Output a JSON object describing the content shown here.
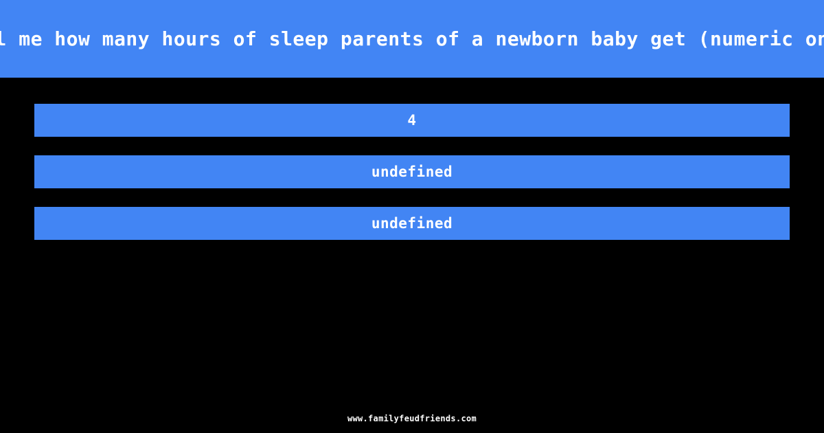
{
  "theme": {
    "background_color": "#000000",
    "accent_color": "#4285f4",
    "text_color": "#ffffff"
  },
  "header": {
    "question": "Tell me how many hours of sleep parents of a newborn baby get (numeric only)"
  },
  "answers": {
    "items": [
      {
        "label": "4"
      },
      {
        "label": "undefined"
      },
      {
        "label": "undefined"
      }
    ]
  },
  "footer": {
    "site": "www.familyfeudfriends.com"
  }
}
